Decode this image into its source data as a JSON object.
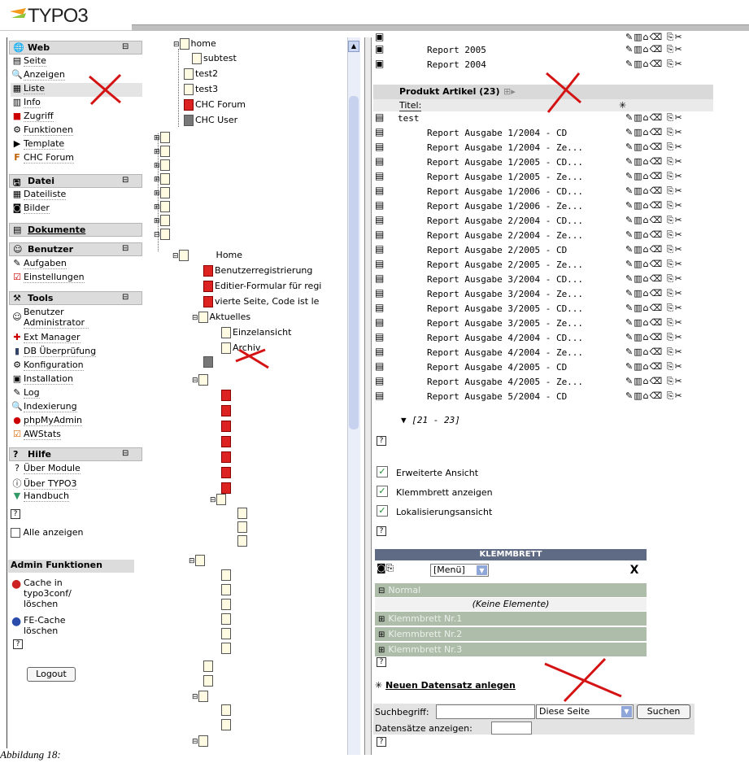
{
  "app": {
    "logo_text": "TYPO3"
  },
  "menu": {
    "groups": [
      {
        "label": "Web",
        "items": [
          "Seite",
          "Anzeigen",
          "Liste",
          "Info",
          "Zugriff",
          "Funktionen",
          "Template",
          "CHC Forum"
        ]
      },
      {
        "label": "Datei",
        "items": [
          "Dateiliste",
          "Bilder"
        ]
      },
      {
        "label": "Dokumente"
      },
      {
        "label": "Benutzer",
        "items": [
          "Aufgaben",
          "Einstellungen"
        ]
      },
      {
        "label": "Tools",
        "items": [
          "Benutzer Administrator",
          "Ext Manager",
          "DB Überprüfung",
          "Konfiguration",
          "Installation",
          "Log",
          "Indexierung",
          "phpMyAdmin",
          "AWStats"
        ]
      },
      {
        "label": "Hilfe",
        "items": [
          "Über Module",
          "Über TYPO3",
          "Handbuch"
        ]
      }
    ],
    "show_all": "Alle anzeigen",
    "collapse_glyph": "⊟",
    "admin": {
      "title": "Admin Funktionen",
      "cache_conf_1": "Cache in",
      "cache_conf_2": "typo3conf/",
      "cache_conf_3": "löschen",
      "fe_cache_1": "FE-Cache",
      "fe_cache_2": "löschen"
    },
    "logout": "Logout"
  },
  "tree": {
    "home": "home",
    "subtest": "subtest",
    "test2": "test2",
    "test3": "test3",
    "chc_forum": "CHC Forum",
    "chc_user": "CHC User",
    "home2": "Home",
    "reg": "Benutzerregistrierung",
    "edit": "Editier-Formular für regi",
    "vierte": "vierte Seite, Code ist le",
    "aktuelles": "Aktuelles",
    "einzel": "Einzelansicht",
    "archiv": "Archiv"
  },
  "list": {
    "top_rows": [
      "Report 2005",
      "Report 2004"
    ],
    "table_title": "Produkt Artikel (23)",
    "column_title": "Titel:",
    "rows": [
      "test",
      "Report Ausgabe 1/2004 - CD",
      "Report Ausgabe 1/2004 - Ze...",
      "Report Ausgabe 1/2005 - CD...",
      "Report Ausgabe 1/2005 - Ze...",
      "Report Ausgabe 1/2006 - CD...",
      "Report Ausgabe 1/2006 - Ze...",
      "Report Ausgabe 2/2004 - CD...",
      "Report Ausgabe 2/2004 - Ze...",
      "Report Ausgabe 2/2005 - CD",
      "Report Ausgabe 2/2005 - Ze...",
      "Report Ausgabe 3/2004 - CD...",
      "Report Ausgabe 3/2004 - Ze...",
      "Report Ausgabe 3/2005 - CD...",
      "Report Ausgabe 3/2005 - Ze...",
      "Report Ausgabe 4/2004 - CD...",
      "Report Ausgabe 4/2004 - Ze...",
      "Report Ausgabe 4/2005 - CD",
      "Report Ausgabe 4/2005 - Ze...",
      "Report Ausgabe 5/2004 - CD"
    ],
    "range": "[21 - 23]",
    "help": "?",
    "options": [
      "Erweiterte Ansicht",
      "Klemmbrett anzeigen",
      "Lokalisierungsansicht"
    ],
    "clipboard": {
      "title": "KLEMMBRETT",
      "menu_value": "[Menü]",
      "close": "X",
      "normal": "Normal",
      "empty": "(Keine Elemente)",
      "pads": [
        "Klemmbrett Nr.1",
        "Klemmbrett Nr.2",
        "Klemmbrett Nr.3"
      ]
    },
    "new_record": "Neuen Datensatz anlegen",
    "search": {
      "label": "Suchbegriff:",
      "scope": "Diese Seite",
      "button": "Suchen",
      "count_label": "Datensätze anzeigen:"
    }
  },
  "caption": "Abbildung 18:",
  "colors": {
    "marker": "#d41414",
    "group_bg": "#dcdcdc",
    "clipboard_row": "#aebdaa"
  }
}
